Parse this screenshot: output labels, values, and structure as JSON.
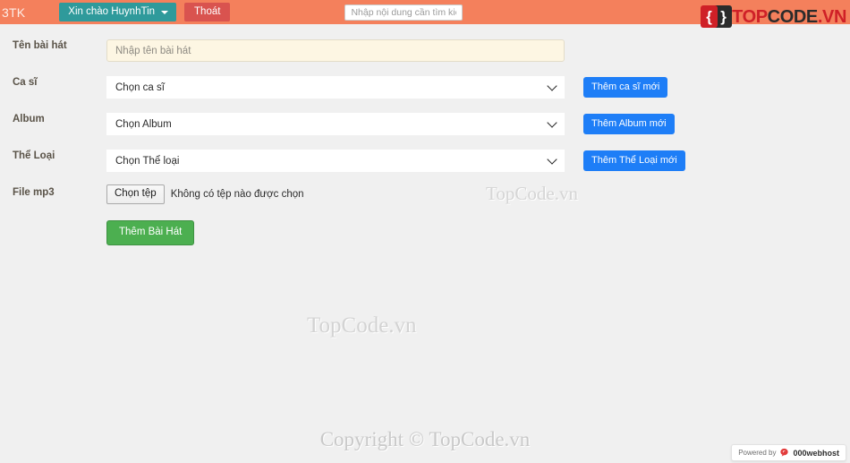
{
  "navbar": {
    "brand": "3TK",
    "greeting_label": "Xin chào HuynhTin",
    "logout_label": "Thoát",
    "search_placeholder": "Nhập nội dung cần tìm kiếm",
    "search_value": "",
    "caret_icon": "caret-down-icon"
  },
  "logo": {
    "mark_left": "{",
    "mark_right": "}",
    "word_part1": "TOP",
    "word_part2": "CODE",
    "word_part3": ".VN",
    "colors": {
      "red": "#cf2027",
      "dark": "#2b2b2b"
    }
  },
  "form": {
    "rows": [
      {
        "label": "Tên bài hát",
        "type": "text",
        "placeholder": "Nhập tên bài hát",
        "value": ""
      },
      {
        "label": "Ca sĩ",
        "type": "select",
        "selected": "Chọn ca sĩ",
        "action_label": "Thêm ca sĩ mới"
      },
      {
        "label": "Album",
        "type": "select",
        "selected": "Chọn Album",
        "action_label": "Thêm Album mới"
      },
      {
        "label": "Thể Loại",
        "type": "select",
        "selected": "Chọn Thể loại",
        "action_label": "Thêm Thể Loại mới"
      },
      {
        "label": "File mp3",
        "type": "file",
        "file_button_label": "Chọn tệp",
        "file_status": "Không có tệp nào được chọn"
      }
    ],
    "submit_label": "Thêm Bài Hát",
    "colors": {
      "accent_blue": "#1e7ef7",
      "submit_green": "#4caf50",
      "navbar_orange": "#f4805c",
      "greeting_teal": "#2f9a9b",
      "logout_red": "#d9534f"
    }
  },
  "watermarks": {
    "middle": "TopCode.vn",
    "center": "TopCode.vn"
  },
  "footer": {
    "copyright": "Copyright © TopCode.vn"
  },
  "webhost_badge": {
    "powered_by": "Powered by",
    "provider": "000webhost",
    "icon": "000webhost-swirl-icon"
  }
}
